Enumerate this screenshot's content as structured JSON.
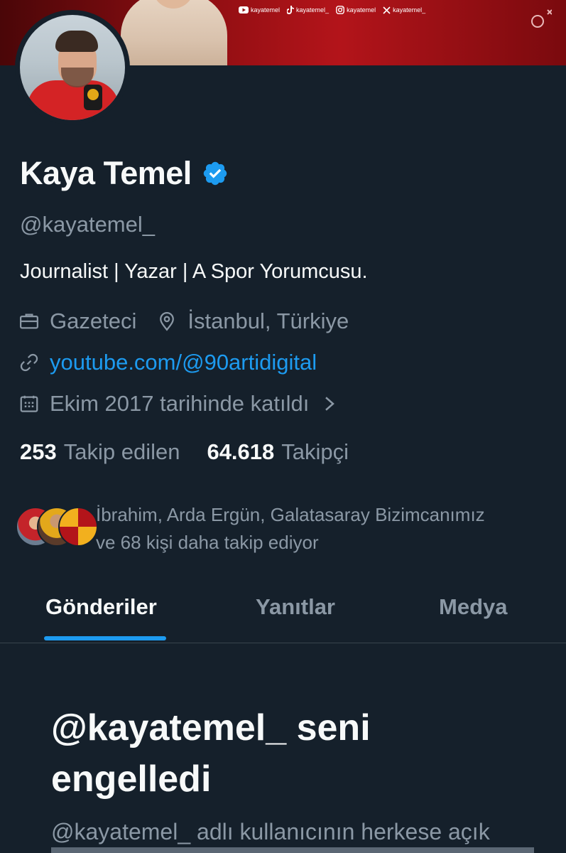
{
  "banner": {
    "socials": [
      {
        "icon": "youtube-icon",
        "label": "kayatemel"
      },
      {
        "icon": "tiktok-icon",
        "label": "kayatemel_"
      },
      {
        "icon": "instagram-icon",
        "label": "kayatemel"
      },
      {
        "icon": "x-icon",
        "label": "kayatemel_"
      }
    ]
  },
  "profile": {
    "name": "Kaya Temel",
    "handle": "@kayatemel_",
    "bio": "Journalist | Yazar | A Spor Yorumcusu.",
    "profession": "Gazeteci",
    "location": "İstanbul, Türkiye",
    "website": "youtube.com/@90artidigital",
    "joined": "Ekim 2017 tarihinde katıldı"
  },
  "counts": {
    "following_num": "253",
    "following_label": "Takip edilen",
    "followers_num": "64.618",
    "followers_label": "Takipçi"
  },
  "followed_by": {
    "line1": "İbrahim, Arda Ergün, Galatasaray Bizimcanımız",
    "line2": "ve 68 kişi daha takip ediyor"
  },
  "tabs": [
    {
      "label": "Gönderiler",
      "active": true
    },
    {
      "label": "Yanıtlar",
      "active": false
    },
    {
      "label": "Medya",
      "active": false
    }
  ],
  "blocked": {
    "title_line1": "@kayatemel_ seni",
    "title_line2": "engelledi",
    "message": "@kayatemel_ adlı kullanıcının herkese açık"
  },
  "colors": {
    "background": "#15202b",
    "text": "#f7f9f9",
    "muted": "#8b98a5",
    "accent": "#1d9bf0",
    "divider": "#38444d"
  }
}
